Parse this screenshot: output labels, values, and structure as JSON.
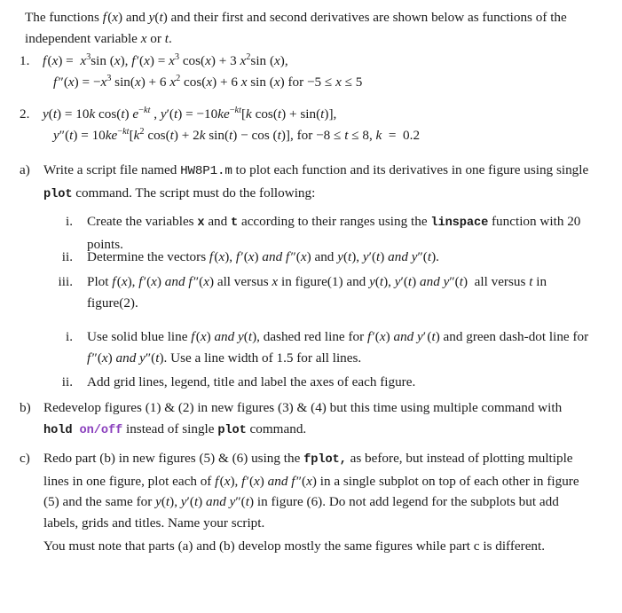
{
  "document": {
    "type": "homework-assignment",
    "text_color": "#1b1b1b",
    "accent_code_color": "#8a3fbd",
    "background": "#ffffff"
  },
  "intro": {
    "line1": "The functions f(x) and y(t) and their first and second derivatives are shown below as",
    "line2": "functions of the independent variable x or t.",
    "full": "The functions f(x) and y(t) and their first and second derivatives are shown below as functions of the independent variable x or t."
  },
  "numbered_items": [
    {
      "marker": "1.",
      "line1": "f(x) =  x³sin (x), f′(x) = x³ cos(x) + 3 x²sin (x),",
      "line2": "f″(x) = −x³ sin(x) + 6 x² cos(x) + 6 x sin (x) for −5 ≤ x ≤ 5",
      "function": "f(x) = x^3 sin(x)",
      "first_derivative": "f'(x) = x^3 cos(x) + 3x^2 sin(x)",
      "second_derivative": "f''(x) = -x^3 sin(x) + 6x^2 cos(x) + 6x sin(x)",
      "domain": "-5 <= x <= 5"
    },
    {
      "marker": "2.",
      "line1": "y(t) = 10k cos(t) e−kt , y′(t) = −10ke−kt[k cos(t) + sin(t)],",
      "line2": "y″(t) = 10ke−kt[k² cos(t) + 2k sin(t) − cos (t)], for −8 ≤ t ≤ 8, k  =  0.2",
      "function": "y(t) = 10k cos(t) e^(-kt)",
      "first_derivative": "y'(t) = -10k e^(-kt)[k cos(t) + sin(t)]",
      "second_derivative": "y''(t) = 10k e^(-kt)[k^2 cos(t) + 2k sin(t) - cos(t)]",
      "domain": "-8 <= t <= 8",
      "k_value": "0.2"
    }
  ],
  "parts": {
    "a": {
      "marker": "a)",
      "text_before_script": "Write a script file named ",
      "script_name": "HW8P1.m",
      "text_after_script": " to plot each function and its derivatives in one figure using single ",
      "plot_command": "plot",
      "text_end": " command. The script must do the following:",
      "subitems": [
        {
          "marker": "i.",
          "text_before": "Create the variables ",
          "var1": "x",
          "text_mid1": " and ",
          "var2": "t",
          "text_mid2": " according to their ranges using the ",
          "func": "linspace",
          "text_end": " function with 20 points."
        },
        {
          "marker": "ii.",
          "text": "Determine the vectors f(x), f′(x) and f″(x) and y(t), y′(t) and y″(t)."
        },
        {
          "marker": "iii.",
          "text": "Plot f(x), f′(x) and f″(x) all versus x in figure(1) and y(t), y′(t) and y″(t)  all versus t in figure(2)."
        },
        {
          "marker": "i.",
          "text": "Use solid blue line f(x) and y(t), dashed red line for f′(x) and y′(t) and green dash-dot line for f″(x) and y″(t). Use a line width of 1.5 for all lines.",
          "line_width": "1.5",
          "colors": [
            "blue",
            "red",
            "green"
          ],
          "styles": [
            "solid",
            "dashed",
            "dash-dot"
          ]
        },
        {
          "marker": "ii.",
          "text": "Add grid lines, legend, title and label the axes of each figure."
        }
      ]
    },
    "b": {
      "marker": "b)",
      "text_before": "Redevelop figures (1) & (2) in new figures (3) & (4) but this time using multiple command with ",
      "hold_command": "hold",
      "onoff_command": "on/off",
      "text_mid": " instead of single ",
      "plot_command": "plot",
      "text_end": " command."
    },
    "c": {
      "marker": "c)",
      "text_before": "Redo part (b) in new figures (5) & (6) using the ",
      "fplot_command": "fplot,",
      "text_end": " as before, but instead of plotting multiple lines in one figure, plot each of f(x), f′(x) and f″(x) in a single subplot on top of each other in figure (5) and the same for y(t), y′(t) and y″(t) in figure (6). Do not add legend for the subplots but add labels, grids and titles. Name your script."
    }
  },
  "note": {
    "line1": "You must note that parts (a) and (b) develop mostly the same figures while part c is",
    "line2": "different.",
    "full": "You must note that parts (a) and (b) develop mostly the same figures while part c is different."
  }
}
